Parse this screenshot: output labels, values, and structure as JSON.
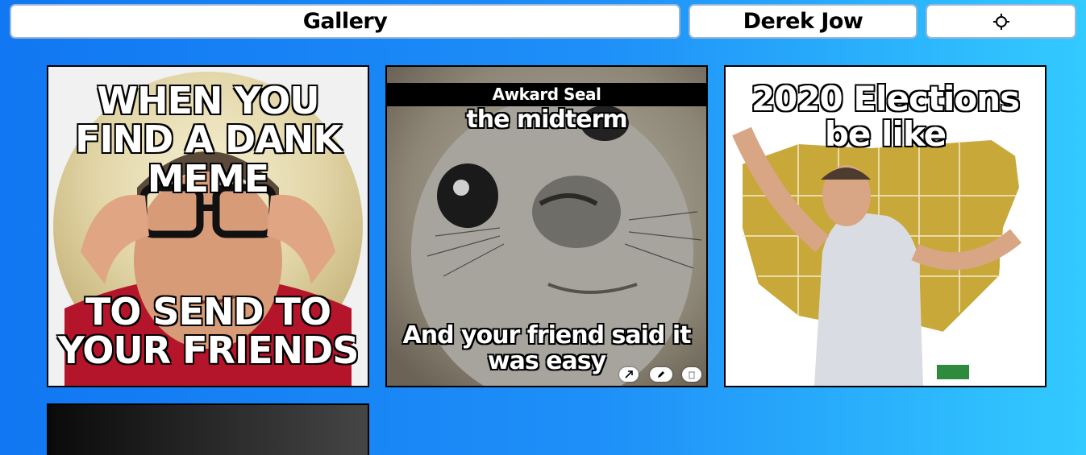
{
  "header": {
    "gallery_label": "Gallery",
    "user_label": "Derek Jow",
    "settings_icon": "settings-sun-icon"
  },
  "cards": [
    {
      "top_text": "WHEN YOU FIND A DANK MEME",
      "bottom_text": "TO SEND TO YOUR FRIENDS"
    },
    {
      "title": "Awkard Seal",
      "top_text": "the midterm",
      "bottom_text": "And your friend said it was easy",
      "actions": [
        "open-icon",
        "edit-icon",
        "delete-icon"
      ]
    },
    {
      "top_text": "2020 Elections be like"
    },
    {}
  ]
}
